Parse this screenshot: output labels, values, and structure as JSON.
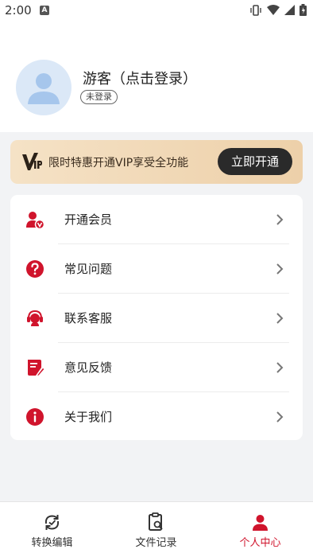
{
  "status_bar": {
    "time": "2:00",
    "notification_letter": "A"
  },
  "profile": {
    "name": "游客（点击登录）",
    "badge": "未登录"
  },
  "vip_banner": {
    "text": "限时特惠开通VIP享受全功能",
    "button_label": "立即开通"
  },
  "menu": {
    "items": [
      {
        "label": "开通会员",
        "icon": "vip-member-icon"
      },
      {
        "label": "常见问题",
        "icon": "question-icon"
      },
      {
        "label": "联系客服",
        "icon": "customer-service-icon"
      },
      {
        "label": "意见反馈",
        "icon": "feedback-icon"
      },
      {
        "label": "关于我们",
        "icon": "info-icon"
      }
    ]
  },
  "tabbar": {
    "tabs": [
      {
        "label": "转换编辑",
        "icon": "convert-icon",
        "active": false
      },
      {
        "label": "文件记录",
        "icon": "file-search-icon",
        "active": false
      },
      {
        "label": "个人中心",
        "icon": "person-icon",
        "active": true
      }
    ]
  },
  "colors": {
    "accent": "#d0142c",
    "vip_gold": "#efd6b2",
    "dark_button": "#2a2a2a",
    "background": "#f2f3f5"
  }
}
